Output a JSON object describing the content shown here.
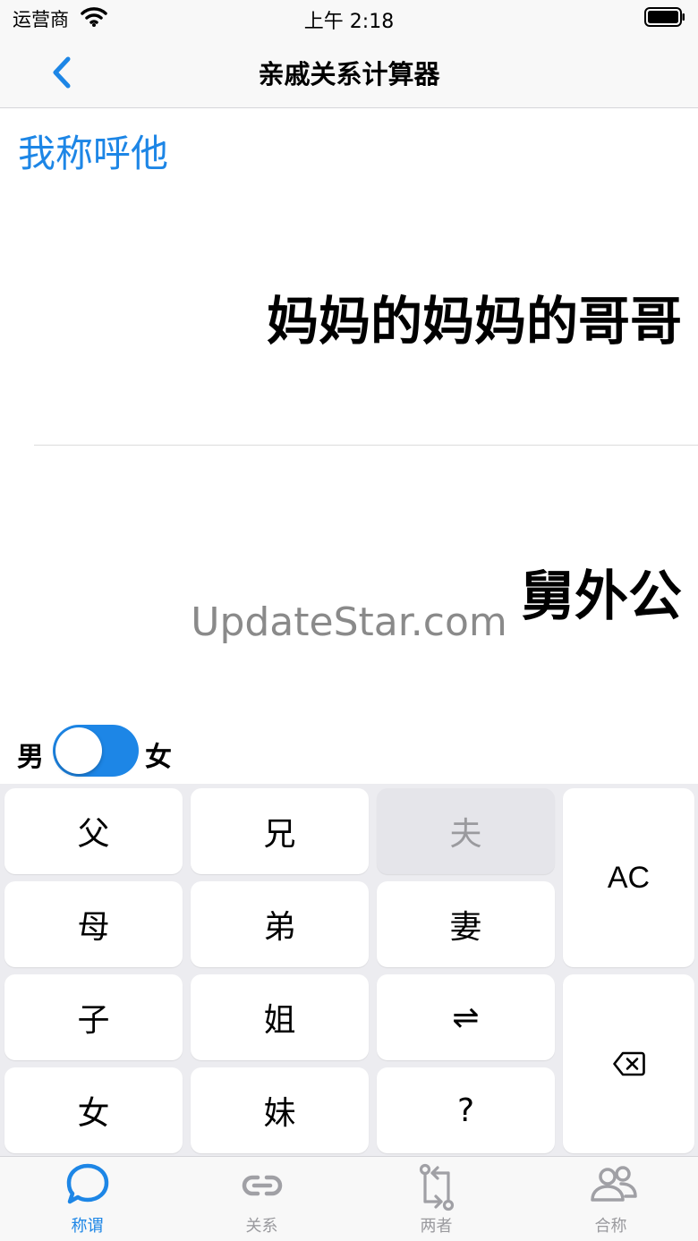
{
  "status_bar": {
    "carrier": "运营商",
    "time": "上午 2:18"
  },
  "nav": {
    "title": "亲戚关系计算器"
  },
  "display": {
    "label": "我称呼他",
    "expression": "妈妈的妈妈的哥哥",
    "result": "舅外公"
  },
  "watermark": "UpdateStar.com",
  "gender": {
    "male": "男",
    "female": "女",
    "selected": "男"
  },
  "keypad": {
    "keys": [
      "父",
      "兄",
      "夫",
      "母",
      "弟",
      "妻",
      "子",
      "姐",
      "⇌",
      "女",
      "妹",
      "?"
    ],
    "ac": "AC",
    "disabled": [
      "夫"
    ]
  },
  "tabs": [
    {
      "label": "称谓",
      "icon": "chat-bubble-icon",
      "active": true
    },
    {
      "label": "关系",
      "icon": "link-icon",
      "active": false
    },
    {
      "label": "两者",
      "icon": "compare-arrows-icon",
      "active": false
    },
    {
      "label": "合称",
      "icon": "people-icon",
      "active": false
    }
  ],
  "colors": {
    "accent": "#1D86E6",
    "disabled_key": "#E5E5EA",
    "keypad_bg": "#ECECF0"
  }
}
